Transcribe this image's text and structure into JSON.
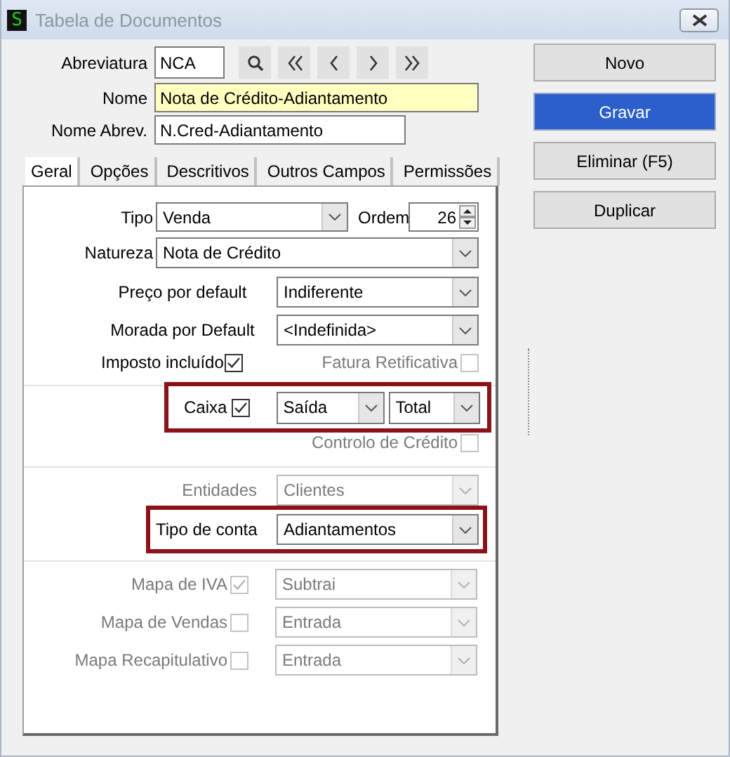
{
  "window": {
    "logo": "S",
    "title": "Tabela de Documentos"
  },
  "header": {
    "abreviatura": {
      "label": "Abreviatura",
      "value": "NCA"
    },
    "nome": {
      "label": "Nome",
      "value": "Nota de Crédito-Adiantamento",
      "highlighted": true
    },
    "nome_abrev": {
      "label": "Nome Abrev.",
      "value": "N.Cred-Adiantamento",
      "highlighted": false
    }
  },
  "tabs": [
    {
      "label": "Geral",
      "selected": true
    },
    {
      "label": "Opções",
      "selected": false
    },
    {
      "label": "Descritivos",
      "selected": false
    },
    {
      "label": "Outros Campos",
      "selected": false
    },
    {
      "label": "Permissões",
      "selected": false
    }
  ],
  "geral": {
    "tipo": {
      "label": "Tipo",
      "value": "Venda"
    },
    "ordem": {
      "label": "Ordem",
      "value": "26"
    },
    "natureza": {
      "label": "Natureza",
      "value": "Nota de Crédito"
    },
    "preco_default": {
      "label": "Preço por default",
      "value": "Indiferente"
    },
    "morada_default": {
      "label": "Morada por Default",
      "value": "<Indefinida>"
    },
    "imposto_incluido": {
      "label": "Imposto incluído",
      "checked": true,
      "disabled": false
    },
    "fatura_retificativa": {
      "label": "Fatura Retificativa",
      "checked": false,
      "disabled": true
    },
    "caixa": {
      "label": "Caixa",
      "checked": true,
      "highlighted": true,
      "direction": "Saída",
      "scope": "Total"
    },
    "controlo_credito": {
      "label": "Controlo de Crédito",
      "checked": false,
      "disabled": true
    },
    "entidades": {
      "label": "Entidades",
      "value": "Clientes",
      "disabled": true
    },
    "tipo_conta": {
      "label": "Tipo de conta",
      "value": "Adiantamentos",
      "highlighted": true
    },
    "mapas": [
      {
        "label": "Mapa de IVA",
        "checked": true,
        "disabled": true,
        "value": "Subtrai"
      },
      {
        "label": "Mapa de Vendas",
        "checked": false,
        "disabled": true,
        "value": "Entrada"
      },
      {
        "label": "Mapa Recapitulativo",
        "checked": false,
        "disabled": true,
        "value": "Entrada"
      }
    ]
  },
  "actions": [
    {
      "label": "Novo",
      "default": false
    },
    {
      "label": "Gravar",
      "default": true
    },
    {
      "label": "Eliminar (F5)",
      "default": false
    },
    {
      "label": "Duplicar",
      "default": false
    }
  ]
}
